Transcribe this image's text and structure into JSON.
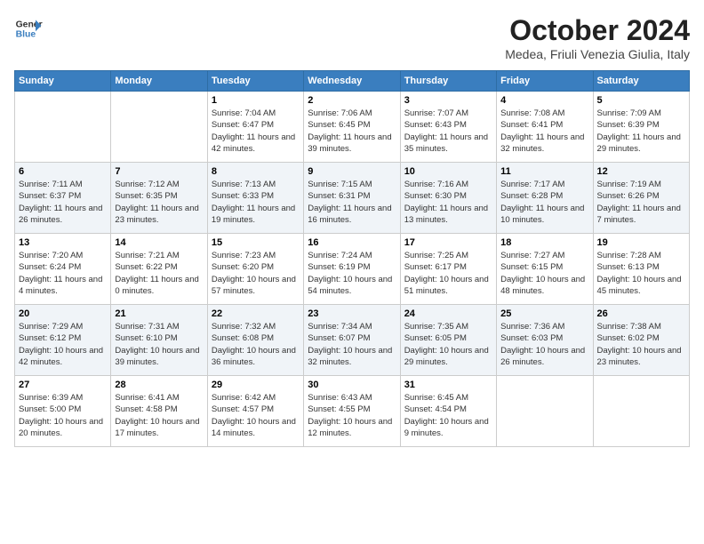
{
  "header": {
    "logo_line1": "General",
    "logo_line2": "Blue",
    "month": "October 2024",
    "location": "Medea, Friuli Venezia Giulia, Italy"
  },
  "weekdays": [
    "Sunday",
    "Monday",
    "Tuesday",
    "Wednesday",
    "Thursday",
    "Friday",
    "Saturday"
  ],
  "weeks": [
    [
      {
        "day": "",
        "sunrise": "",
        "sunset": "",
        "daylight": ""
      },
      {
        "day": "",
        "sunrise": "",
        "sunset": "",
        "daylight": ""
      },
      {
        "day": "1",
        "sunrise": "Sunrise: 7:04 AM",
        "sunset": "Sunset: 6:47 PM",
        "daylight": "Daylight: 11 hours and 42 minutes."
      },
      {
        "day": "2",
        "sunrise": "Sunrise: 7:06 AM",
        "sunset": "Sunset: 6:45 PM",
        "daylight": "Daylight: 11 hours and 39 minutes."
      },
      {
        "day": "3",
        "sunrise": "Sunrise: 7:07 AM",
        "sunset": "Sunset: 6:43 PM",
        "daylight": "Daylight: 11 hours and 35 minutes."
      },
      {
        "day": "4",
        "sunrise": "Sunrise: 7:08 AM",
        "sunset": "Sunset: 6:41 PM",
        "daylight": "Daylight: 11 hours and 32 minutes."
      },
      {
        "day": "5",
        "sunrise": "Sunrise: 7:09 AM",
        "sunset": "Sunset: 6:39 PM",
        "daylight": "Daylight: 11 hours and 29 minutes."
      }
    ],
    [
      {
        "day": "6",
        "sunrise": "Sunrise: 7:11 AM",
        "sunset": "Sunset: 6:37 PM",
        "daylight": "Daylight: 11 hours and 26 minutes."
      },
      {
        "day": "7",
        "sunrise": "Sunrise: 7:12 AM",
        "sunset": "Sunset: 6:35 PM",
        "daylight": "Daylight: 11 hours and 23 minutes."
      },
      {
        "day": "8",
        "sunrise": "Sunrise: 7:13 AM",
        "sunset": "Sunset: 6:33 PM",
        "daylight": "Daylight: 11 hours and 19 minutes."
      },
      {
        "day": "9",
        "sunrise": "Sunrise: 7:15 AM",
        "sunset": "Sunset: 6:31 PM",
        "daylight": "Daylight: 11 hours and 16 minutes."
      },
      {
        "day": "10",
        "sunrise": "Sunrise: 7:16 AM",
        "sunset": "Sunset: 6:30 PM",
        "daylight": "Daylight: 11 hours and 13 minutes."
      },
      {
        "day": "11",
        "sunrise": "Sunrise: 7:17 AM",
        "sunset": "Sunset: 6:28 PM",
        "daylight": "Daylight: 11 hours and 10 minutes."
      },
      {
        "day": "12",
        "sunrise": "Sunrise: 7:19 AM",
        "sunset": "Sunset: 6:26 PM",
        "daylight": "Daylight: 11 hours and 7 minutes."
      }
    ],
    [
      {
        "day": "13",
        "sunrise": "Sunrise: 7:20 AM",
        "sunset": "Sunset: 6:24 PM",
        "daylight": "Daylight: 11 hours and 4 minutes."
      },
      {
        "day": "14",
        "sunrise": "Sunrise: 7:21 AM",
        "sunset": "Sunset: 6:22 PM",
        "daylight": "Daylight: 11 hours and 0 minutes."
      },
      {
        "day": "15",
        "sunrise": "Sunrise: 7:23 AM",
        "sunset": "Sunset: 6:20 PM",
        "daylight": "Daylight: 10 hours and 57 minutes."
      },
      {
        "day": "16",
        "sunrise": "Sunrise: 7:24 AM",
        "sunset": "Sunset: 6:19 PM",
        "daylight": "Daylight: 10 hours and 54 minutes."
      },
      {
        "day": "17",
        "sunrise": "Sunrise: 7:25 AM",
        "sunset": "Sunset: 6:17 PM",
        "daylight": "Daylight: 10 hours and 51 minutes."
      },
      {
        "day": "18",
        "sunrise": "Sunrise: 7:27 AM",
        "sunset": "Sunset: 6:15 PM",
        "daylight": "Daylight: 10 hours and 48 minutes."
      },
      {
        "day": "19",
        "sunrise": "Sunrise: 7:28 AM",
        "sunset": "Sunset: 6:13 PM",
        "daylight": "Daylight: 10 hours and 45 minutes."
      }
    ],
    [
      {
        "day": "20",
        "sunrise": "Sunrise: 7:29 AM",
        "sunset": "Sunset: 6:12 PM",
        "daylight": "Daylight: 10 hours and 42 minutes."
      },
      {
        "day": "21",
        "sunrise": "Sunrise: 7:31 AM",
        "sunset": "Sunset: 6:10 PM",
        "daylight": "Daylight: 10 hours and 39 minutes."
      },
      {
        "day": "22",
        "sunrise": "Sunrise: 7:32 AM",
        "sunset": "Sunset: 6:08 PM",
        "daylight": "Daylight: 10 hours and 36 minutes."
      },
      {
        "day": "23",
        "sunrise": "Sunrise: 7:34 AM",
        "sunset": "Sunset: 6:07 PM",
        "daylight": "Daylight: 10 hours and 32 minutes."
      },
      {
        "day": "24",
        "sunrise": "Sunrise: 7:35 AM",
        "sunset": "Sunset: 6:05 PM",
        "daylight": "Daylight: 10 hours and 29 minutes."
      },
      {
        "day": "25",
        "sunrise": "Sunrise: 7:36 AM",
        "sunset": "Sunset: 6:03 PM",
        "daylight": "Daylight: 10 hours and 26 minutes."
      },
      {
        "day": "26",
        "sunrise": "Sunrise: 7:38 AM",
        "sunset": "Sunset: 6:02 PM",
        "daylight": "Daylight: 10 hours and 23 minutes."
      }
    ],
    [
      {
        "day": "27",
        "sunrise": "Sunrise: 6:39 AM",
        "sunset": "Sunset: 5:00 PM",
        "daylight": "Daylight: 10 hours and 20 minutes."
      },
      {
        "day": "28",
        "sunrise": "Sunrise: 6:41 AM",
        "sunset": "Sunset: 4:58 PM",
        "daylight": "Daylight: 10 hours and 17 minutes."
      },
      {
        "day": "29",
        "sunrise": "Sunrise: 6:42 AM",
        "sunset": "Sunset: 4:57 PM",
        "daylight": "Daylight: 10 hours and 14 minutes."
      },
      {
        "day": "30",
        "sunrise": "Sunrise: 6:43 AM",
        "sunset": "Sunset: 4:55 PM",
        "daylight": "Daylight: 10 hours and 12 minutes."
      },
      {
        "day": "31",
        "sunrise": "Sunrise: 6:45 AM",
        "sunset": "Sunset: 4:54 PM",
        "daylight": "Daylight: 10 hours and 9 minutes."
      },
      {
        "day": "",
        "sunrise": "",
        "sunset": "",
        "daylight": ""
      },
      {
        "day": "",
        "sunrise": "",
        "sunset": "",
        "daylight": ""
      }
    ]
  ]
}
